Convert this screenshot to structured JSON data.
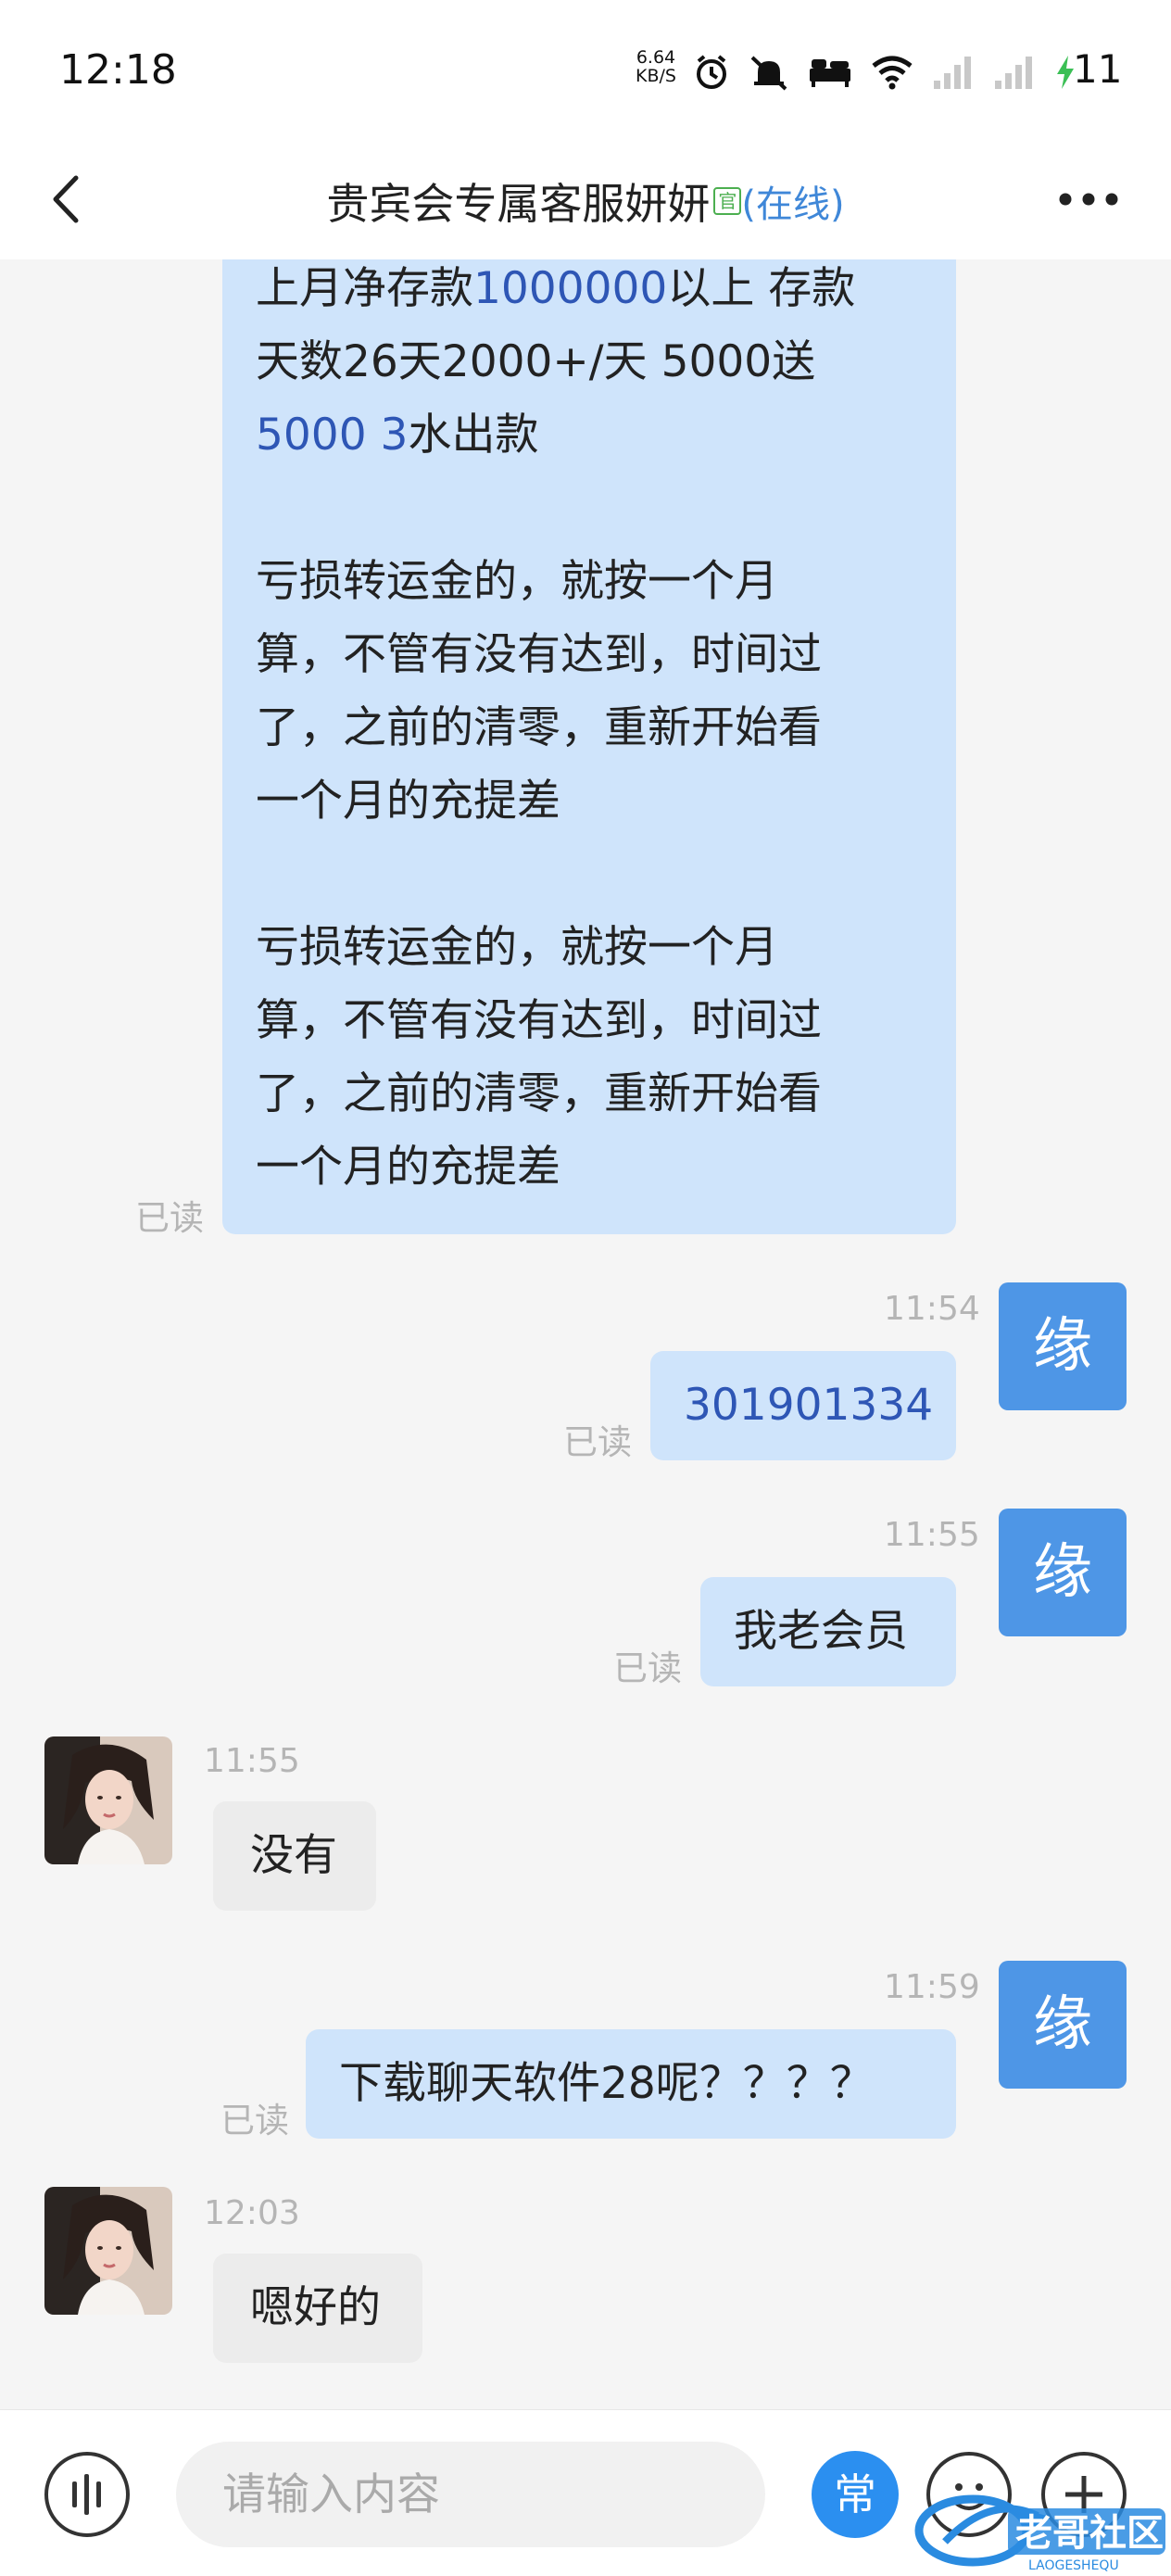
{
  "status_bar": {
    "time": "12:18",
    "net_speed_value": "6.64",
    "net_speed_unit": "KB/S",
    "battery_level": "11",
    "icons": [
      "alarm-icon",
      "mute-icon",
      "bed-icon",
      "wifi-icon",
      "signal-icon",
      "signal-icon",
      "charging-icon"
    ]
  },
  "header": {
    "title": "贵宾会专属客服妍妍",
    "official_badge": "官",
    "online_status": "(在线)",
    "back_icon": "chevron-left-icon",
    "more_icon": "more-dots-icon"
  },
  "messages": {
    "m1": {
      "p1_a": "上月净存款",
      "p1_b": "1000000",
      "p1_c": "以上 存款",
      "p1_d": "天数26天2000+/天 5000送",
      "p1_e": "5000 3",
      "p1_f": "水出款",
      "p2_l1": "亏损转运金的，就按一个月",
      "p2_l2": "算，不管有没有达到，时间过",
      "p2_l3": "了，之前的清零，重新开始看",
      "p2_l4": "一个月的充提差",
      "p3_l1": "亏损转运金的，就按一个月",
      "p3_l2": "算，不管有没有达到，时间过",
      "p3_l3": "了，之前的清零，重新开始看",
      "p3_l4": "一个月的充提差",
      "read": "已读"
    },
    "m2": {
      "time": "11:54",
      "text": "301901334",
      "read": "已读",
      "avatar": "缘"
    },
    "m3": {
      "time": "11:55",
      "text": "我老会员",
      "read": "已读",
      "avatar": "缘"
    },
    "m4": {
      "time": "11:55",
      "text": "没有"
    },
    "m5": {
      "time": "11:59",
      "text": "下载聊天软件28呢？？？？",
      "read": "已读",
      "avatar": "缘"
    },
    "m6": {
      "time": "12:03",
      "text": "嗯好的"
    }
  },
  "input_bar": {
    "placeholder": "请输入内容",
    "quick_reply_label": "常",
    "voice_icon": "voice-icon",
    "emoji_icon": "emoji-icon",
    "plus_icon": "plus-icon"
  },
  "colors": {
    "outgoing_bubble": "#cfe4fb",
    "incoming_bubble": "#ececec",
    "avatar_blue": "#4e96e6",
    "link_blue": "#2e56b5",
    "online_blue": "#3f87d8"
  }
}
